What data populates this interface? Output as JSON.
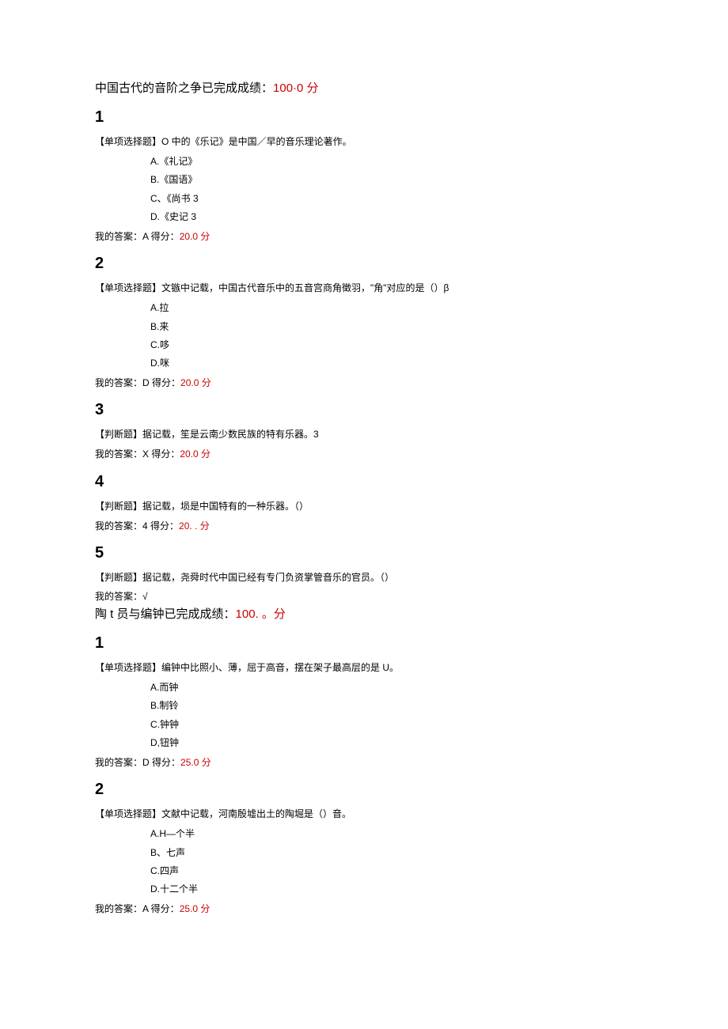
{
  "sections": [
    {
      "title_black": "中国古代的音阶之争已完成成绩：",
      "title_red": "100·0 分",
      "questions": [
        {
          "num": "1",
          "stem": "【单项选择题】O 中的《乐记》是中国／早的音乐理论著作。",
          "options": [
            "A.《礼记》",
            "B.《国语》",
            "C、《尚书 3",
            "D.《史记 3"
          ],
          "answer_black": "我的答案：A 得分：",
          "answer_red": "20.0 分"
        },
        {
          "num": "2",
          "stem": "【单项选择题】文镞中记载，中国古代音乐中的五音宫商角徵羽，\"角\"对应的是（）β",
          "options": [
            "A.拉",
            "B.来",
            "C.哆",
            "D.咪"
          ],
          "answer_black": "我的答案：D 得分：",
          "answer_red": "20.0 分"
        },
        {
          "num": "3",
          "stem": "【判断题】据记载，笙是云南少数民族的特有乐器。3",
          "options": [],
          "answer_black": "我的答案：X 得分：",
          "answer_red": "20.0 分"
        },
        {
          "num": "4",
          "stem": "【判断题】据记载，埙是中国特有的一种乐器。（）",
          "options": [],
          "answer_black": "我的答案：4 得分：",
          "answer_red": "20. . 分"
        },
        {
          "num": "5",
          "stem": "【判断题】据记载，尧舜时代中国已经有专门负资掌管音乐的官员。（）",
          "options": [],
          "answer_black": "我的答案：√",
          "answer_red": ""
        }
      ]
    },
    {
      "title_black": "陶 t 员与编钟已完成成绩：",
      "title_red": "100. 。分",
      "questions": [
        {
          "num": "1",
          "stem": "【单项选择题】编钟中比照小、薄，屈于高音，摆在架子最高层的是 U。",
          "options": [
            "A.而钟",
            "B.制铃",
            "C.钟钟",
            "D,钮钟"
          ],
          "answer_black": "我的答案：D 得分：",
          "answer_red": "25.0 分"
        },
        {
          "num": "2",
          "stem": "【单项选择题】文献中记载，河南殷墟出土的陶堀是（）音。",
          "options": [
            "A.H—个半",
            "B、七声",
            "C.四声",
            "D.十二个半"
          ],
          "answer_black": "我的答案：A 得分：",
          "answer_red": "25.0 分"
        }
      ]
    }
  ]
}
